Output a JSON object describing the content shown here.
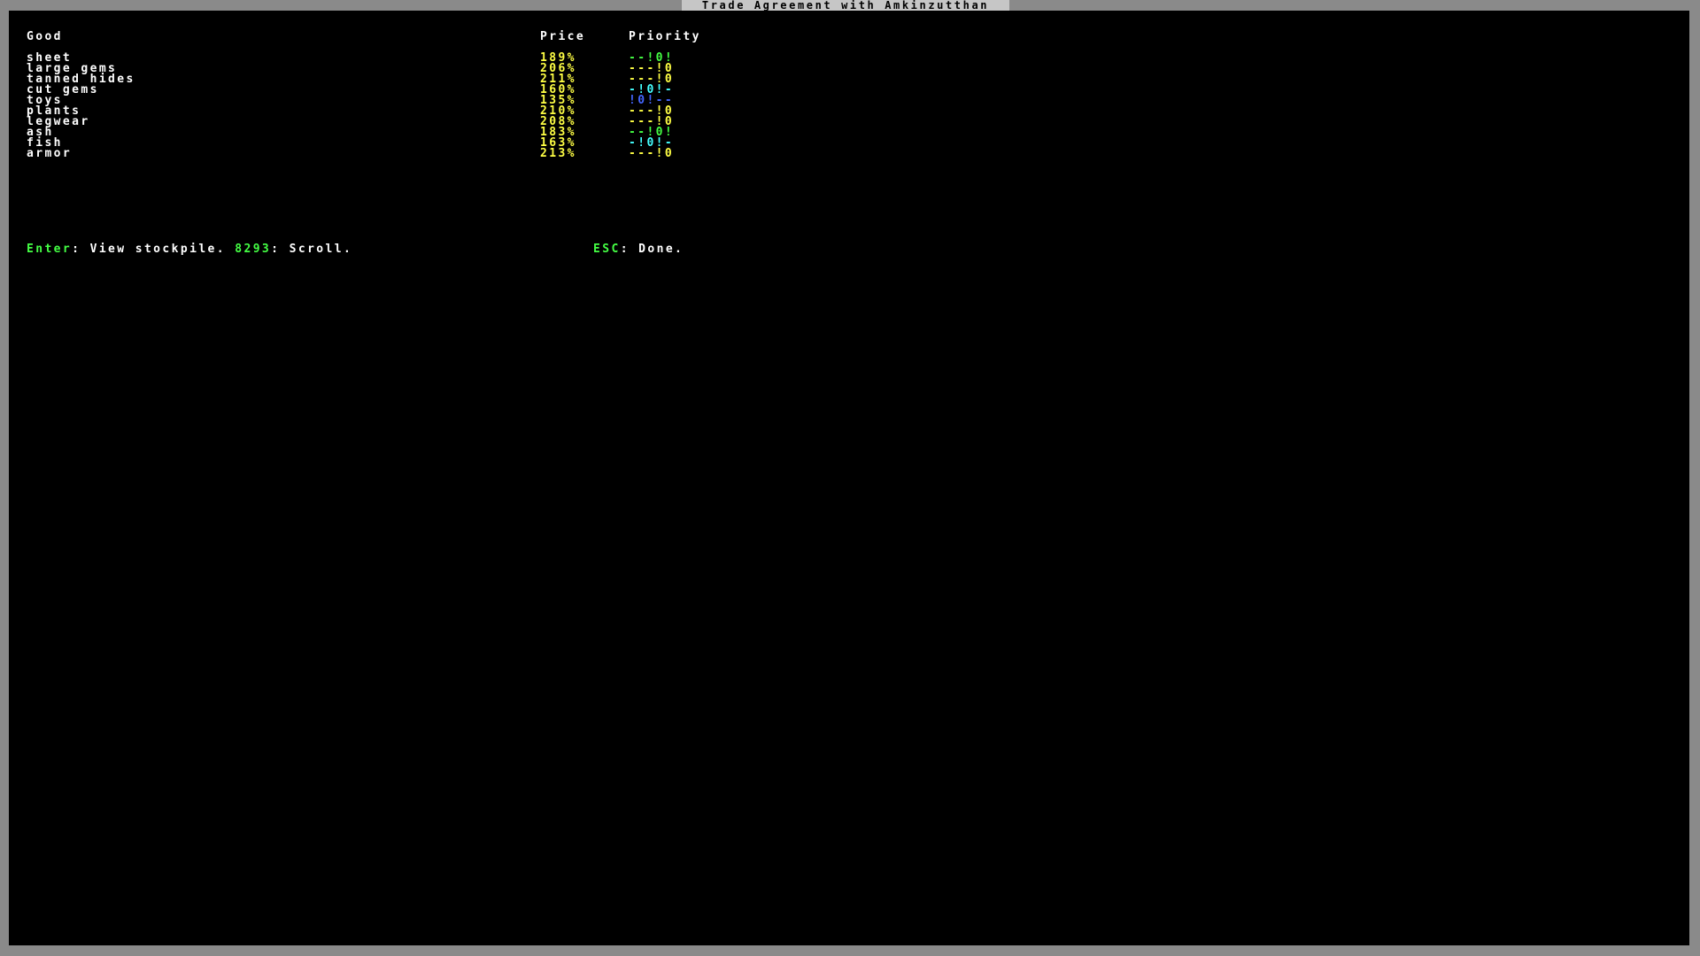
{
  "title": "Trade Agreement with Amkinzutthan",
  "headers": {
    "good": "Good",
    "price": "Price",
    "priority": "Priority"
  },
  "goods": [
    {
      "name": "sheet",
      "price": "189%",
      "priority": "--!0!",
      "priority_color": "green"
    },
    {
      "name": "large gems",
      "price": "206%",
      "priority": "---!0",
      "priority_color": "yellow"
    },
    {
      "name": "tanned hides",
      "price": "211%",
      "priority": "---!0",
      "priority_color": "yellow"
    },
    {
      "name": "cut gems",
      "price": "160%",
      "priority": "-!0!-",
      "priority_color": "cyan"
    },
    {
      "name": "toys",
      "price": "135%",
      "priority": "!0!--",
      "priority_color": "blue"
    },
    {
      "name": "plants",
      "price": "210%",
      "priority": "---!0",
      "priority_color": "yellow"
    },
    {
      "name": "legwear",
      "price": "208%",
      "priority": "---!0",
      "priority_color": "yellow"
    },
    {
      "name": "ash",
      "price": "183%",
      "priority": "--!0!",
      "priority_color": "green"
    },
    {
      "name": "fish",
      "price": "163%",
      "priority": "-!0!-",
      "priority_color": "cyan"
    },
    {
      "name": "armor",
      "price": "213%",
      "priority": "---!0",
      "priority_color": "yellow"
    }
  ],
  "footer": {
    "enter_key": "Enter",
    "enter_text": ": View stockpile. ",
    "scroll_key": "8293",
    "scroll_text": ": Scroll.",
    "esc_key": "ESC",
    "esc_text": ": Done."
  },
  "colors": {
    "background": "#000000",
    "border": "#8a8a8a",
    "text": "#ffffff",
    "price": "#ffff44",
    "key": "#44ff44",
    "green": "#44ff44",
    "yellow": "#ffff44",
    "cyan": "#44ffff",
    "blue": "#4466ff"
  }
}
